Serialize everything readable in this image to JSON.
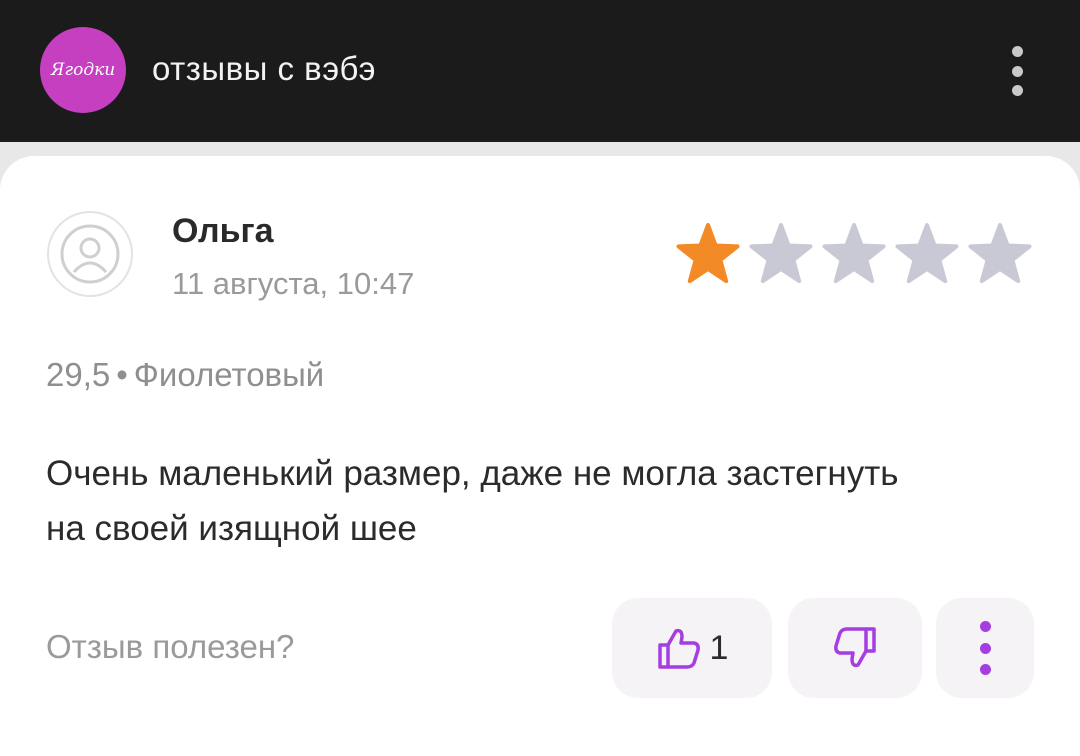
{
  "header": {
    "logo_text": "Ягодки",
    "channel_title": "отзывы с вэбэ",
    "more_icon": "kebab-menu-icon"
  },
  "review": {
    "author": "Ольга",
    "date": "11 августа, 10:47",
    "rating": 1,
    "rating_max": 5,
    "size": "29,5",
    "separator": "•",
    "color": "Фиолетовый",
    "text": "Очень маленький размер, даже не могла застегнуть на своей изящной шее",
    "helpful_label": "Отзыв полезен?",
    "likes": "1"
  },
  "colors": {
    "star_filled": "#f28a25",
    "star_empty": "#c9c9d6",
    "accent": "#a43ee0",
    "logo_bg": "#c73fc1"
  }
}
